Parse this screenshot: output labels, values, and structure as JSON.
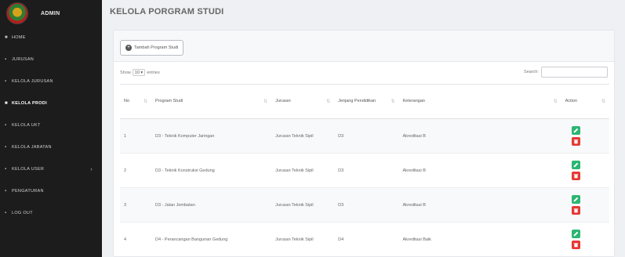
{
  "sidebar": {
    "brand": "ADMIN",
    "items": [
      {
        "icon": "■",
        "label": "HOME"
      },
      {
        "icon": "▪",
        "label": "JURUSAN"
      },
      {
        "icon": "▪",
        "label": "KELOLA JURUSAN"
      },
      {
        "icon": "■",
        "label": "KELOLA PRODI"
      },
      {
        "icon": "▪",
        "label": "KELOLA UKT"
      },
      {
        "icon": "▪",
        "label": "KELOLA JABATAN"
      },
      {
        "icon": "▪",
        "label": "KELOLA USER",
        "caret": "›"
      },
      {
        "icon": "▪",
        "label": "PENGATURAN"
      },
      {
        "icon": "▪",
        "label": "LOG OUT"
      }
    ]
  },
  "page": {
    "title": "KELOLA PORGRAM STUDI"
  },
  "panel": {
    "add_label": "Tambah Program Studi",
    "show_label": "Show",
    "show_value": "10",
    "entries_label": "entries",
    "search_label": "Search:",
    "search_value": ""
  },
  "table": {
    "headers": {
      "no": "No",
      "prodi": "Program Studi",
      "jurusan": "Jurusan",
      "jenjang": "Jenjang Pendidikan",
      "keterangan": "Keterangan",
      "aksi": "Action"
    },
    "rows": [
      {
        "no": "1",
        "prodi": "D3 - Teknik Komputer Jaringan",
        "jurusan": "Jurusan Teknik Sipil",
        "jenjang": "D3",
        "keterangan": "Akreditasi B"
      },
      {
        "no": "2",
        "prodi": "D3 - Teknik Konstruksi Gedung",
        "jurusan": "Jurusan Teknik Sipil",
        "jenjang": "D3",
        "keterangan": "Akreditasi B"
      },
      {
        "no": "3",
        "prodi": "D3 - Jalan Jembatan",
        "jurusan": "Jurusan Teknik Sipil",
        "jenjang": "D3",
        "keterangan": "Akreditasi B"
      },
      {
        "no": "4",
        "prodi": "D4 - Perancangan Bangunan Gedung",
        "jurusan": "Jurusan Teknik Sipil",
        "jenjang": "D4",
        "keterangan": "Akreditasi Baik"
      }
    ]
  },
  "colors": {
    "sidebar_bg": "#1c1c1c",
    "edit": "#2bb673",
    "delete": "#e53935"
  }
}
